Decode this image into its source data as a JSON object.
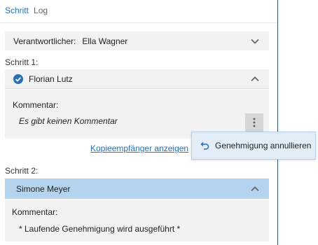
{
  "tabs": {
    "active": "Schritt",
    "other": "Log"
  },
  "responsible": {
    "label": "Verantwortlicher:",
    "value": "Ella Wagner"
  },
  "step1": {
    "label": "Schritt 1:",
    "approver": "Florian Lutz",
    "comment_label": "Kommentar:",
    "comment_value": "Es gibt keinen Kommentar",
    "copy_link": "Kopieempfänger anzeigen"
  },
  "popup": {
    "label": "Genehmigung annullieren"
  },
  "step2": {
    "label": "Schritt 2:",
    "approver": "Simone Meyer",
    "comment_label": "Kommentar:",
    "comment_value": "* Laufende Genehmigung wird ausgeführt *"
  },
  "colors": {
    "accent": "#2a6fb5",
    "selected_row": "#b3d3ee",
    "popup_bg": "#e2edf7",
    "divider": "#2b5777"
  },
  "icons": {
    "approved": "check-circle-icon",
    "collapse": "chevron-up-icon",
    "expand": "chevron-down-icon",
    "more": "more-vertical-icon",
    "undo": "undo-icon"
  }
}
